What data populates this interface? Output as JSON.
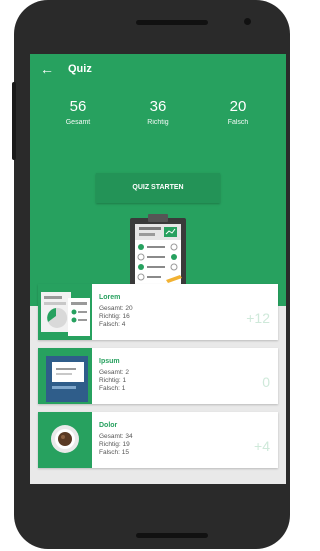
{
  "appbar": {
    "title": "Quiz"
  },
  "stats": [
    {
      "value": "56",
      "label": "Gesamt"
    },
    {
      "value": "36",
      "label": "Richtig"
    },
    {
      "value": "20",
      "label": "Falsch"
    }
  ],
  "start_button": "QUIZ STARTEN",
  "quizzes": [
    {
      "title": "Lorem",
      "total": "Gesamt: 20",
      "correct": "Richtig: 16",
      "wrong": "Falsch: 4",
      "score": "+12"
    },
    {
      "title": "Ipsum",
      "total": "Gesamt: 2",
      "correct": "Richtig: 1",
      "wrong": "Falsch: 1",
      "score": "0"
    },
    {
      "title": "Dolor",
      "total": "Gesamt: 34",
      "correct": "Richtig: 19",
      "wrong": "Falsch: 15",
      "score": "+4"
    }
  ],
  "colors": {
    "primary": "#27a15f",
    "button": "#239357",
    "background": "#e9e9e9",
    "score": "#cfe9da"
  }
}
